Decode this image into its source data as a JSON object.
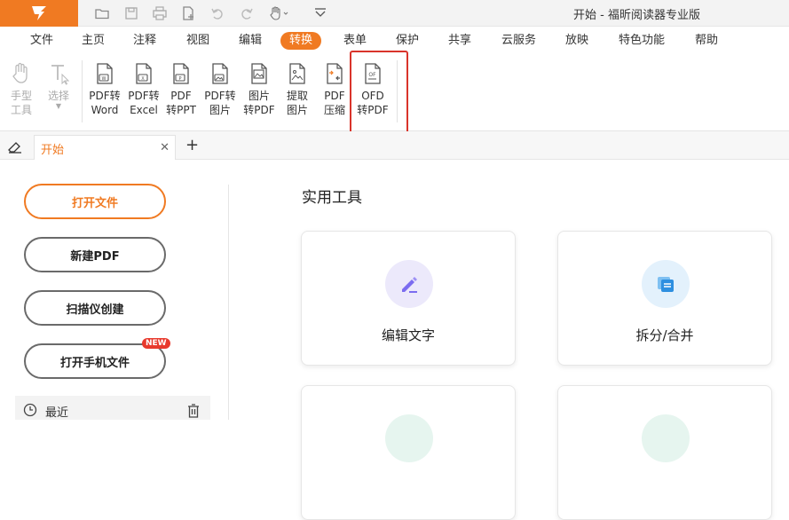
{
  "app": {
    "title": "开始 - 福昕阅读器专业版",
    "accent_color": "#f07a22"
  },
  "quick_access": [
    {
      "icon": "folder-open-icon"
    },
    {
      "icon": "save-icon"
    },
    {
      "icon": "print-icon"
    },
    {
      "icon": "new-document-icon"
    },
    {
      "icon": "undo-icon"
    },
    {
      "icon": "redo-icon"
    },
    {
      "icon": "hand-icon"
    },
    {
      "icon": "customize-dropdown-icon"
    }
  ],
  "menu": {
    "items": [
      "文件",
      "主页",
      "注释",
      "视图",
      "编辑",
      "转换",
      "表单",
      "保护",
      "共享",
      "云服务",
      "放映",
      "特色功能",
      "帮助"
    ],
    "active": "转换"
  },
  "ribbon": {
    "tools": [
      {
        "id": "hand",
        "label": "手型\n工具",
        "icon": "hand-tool-icon",
        "disabled": true
      },
      {
        "id": "select",
        "label": "选择",
        "icon": "select-text-icon",
        "disabled": true
      },
      {
        "id": "pdf2word",
        "label": "PDF转\nWord",
        "icon": "pdf-to-word-icon"
      },
      {
        "id": "pdf2excel",
        "label": "PDF转\nExcel",
        "icon": "pdf-to-excel-icon"
      },
      {
        "id": "pdf2ppt",
        "label": "PDF\n转PPT",
        "icon": "pdf-to-ppt-icon"
      },
      {
        "id": "pdf2img",
        "label": "PDF转\n图片",
        "icon": "pdf-to-image-icon"
      },
      {
        "id": "img2pdf",
        "label": "图片\n转PDF",
        "icon": "image-to-pdf-icon"
      },
      {
        "id": "extract",
        "label": "提取\n图片",
        "icon": "extract-image-icon"
      },
      {
        "id": "compress",
        "label": "PDF\n压缩",
        "icon": "pdf-compress-icon"
      },
      {
        "id": "ofd2pdf",
        "label": "OFD\n转PDF",
        "icon": "ofd-to-pdf-icon"
      }
    ]
  },
  "tabs": {
    "doc_tab_label": "开始",
    "close": "✕",
    "add": "+"
  },
  "left_panel": {
    "open_file": "打开文件",
    "new_pdf": "新建PDF",
    "scan_create": "扫描仪创建",
    "open_phone_file": "打开手机文件",
    "new_badge": "NEW",
    "recent": "最近"
  },
  "main": {
    "section_title": "实用工具",
    "cards": [
      {
        "label": "编辑文字",
        "icon": "edit-text-icon",
        "icon_bg": "#ece9fb",
        "icon_color": "#7b6cf0"
      },
      {
        "label": "拆分/合并",
        "icon": "split-merge-icon",
        "icon_bg": "#e3f1fc",
        "icon_color": "#2e8fe0"
      }
    ]
  }
}
